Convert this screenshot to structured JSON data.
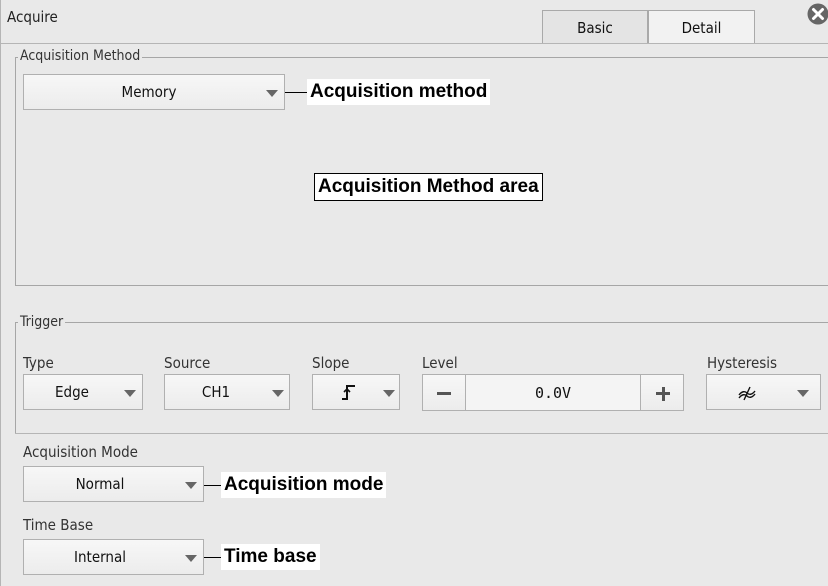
{
  "window": {
    "title": "Acquire",
    "tabs": [
      {
        "label": "Basic"
      },
      {
        "label": "Detail"
      }
    ],
    "close_icon": "close-circle-icon"
  },
  "acquisition_method": {
    "group_label": "Acquisition Method",
    "value": "Memory",
    "callout": "Acquisition method",
    "area_callout": "Acquisition Method area"
  },
  "trigger": {
    "group_label": "Trigger",
    "type": {
      "label": "Type",
      "value": "Edge"
    },
    "source": {
      "label": "Source",
      "value": "CH1"
    },
    "slope": {
      "label": "Slope",
      "value": "rising-edge-icon"
    },
    "level": {
      "label": "Level",
      "value": "0.0V"
    },
    "hysteresis": {
      "label": "Hysteresis",
      "value": "hysteresis-icon"
    }
  },
  "acquisition_mode": {
    "label": "Acquisition Mode",
    "value": "Normal",
    "callout": "Acquisition mode"
  },
  "time_base": {
    "label": "Time Base",
    "value": "Internal",
    "callout": "Time base"
  }
}
